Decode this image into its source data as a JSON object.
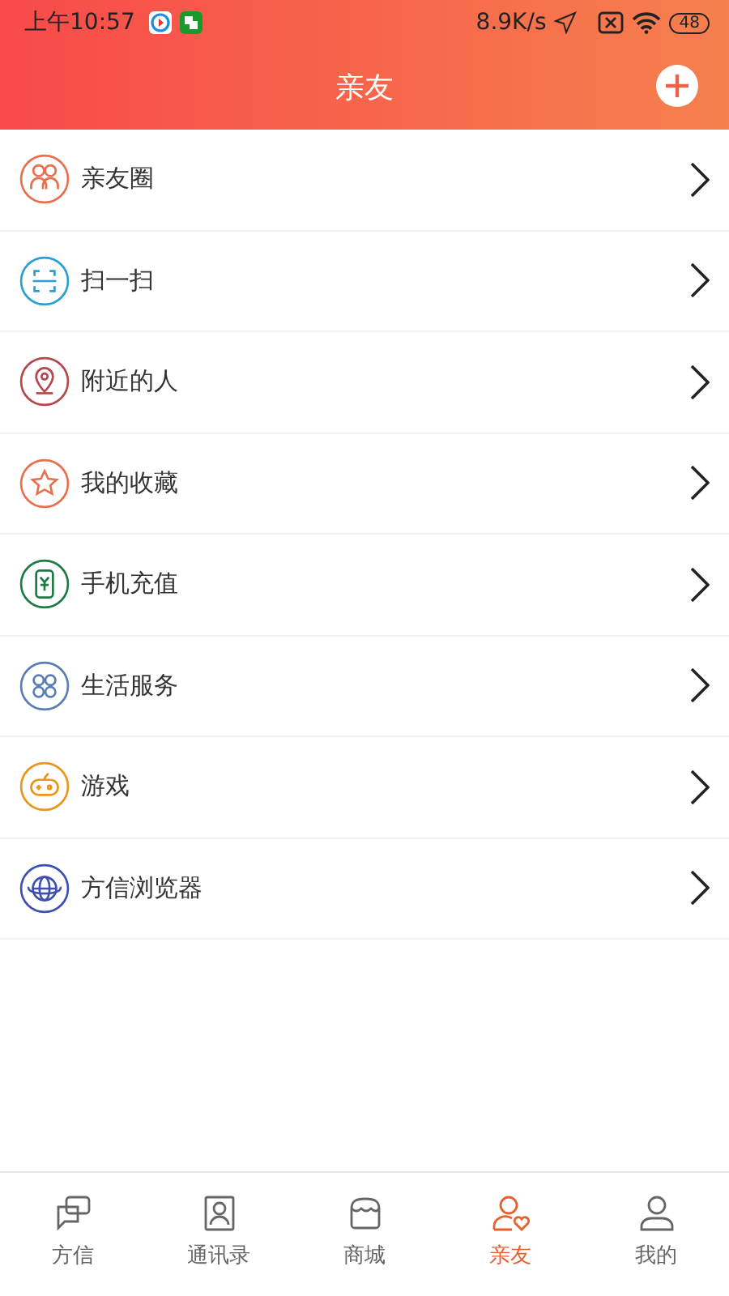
{
  "status_bar": {
    "time": "上午10:57",
    "speed": "8.9K/s",
    "battery": "48"
  },
  "header": {
    "title": "亲友"
  },
  "menu": [
    {
      "kind": "friends",
      "label": "亲友圈",
      "color": "#e8704f"
    },
    {
      "kind": "scan",
      "label": "扫一扫",
      "color": "#2a9fd0"
    },
    {
      "kind": "location",
      "label": "附近的人",
      "color": "#b5474e"
    },
    {
      "kind": "star",
      "label": "我的收藏",
      "color": "#e8704f"
    },
    {
      "kind": "recharge",
      "label": "手机充值",
      "color": "#1e7a45"
    },
    {
      "kind": "services",
      "label": "生活服务",
      "color": "#5a7db5"
    },
    {
      "kind": "game",
      "label": "游戏",
      "color": "#e8961e"
    },
    {
      "kind": "browser",
      "label": "方信浏览器",
      "color": "#3f4fb0"
    }
  ],
  "tabs": [
    {
      "kind": "chat",
      "label": "方信",
      "selected": false
    },
    {
      "kind": "contacts",
      "label": "通讯录",
      "selected": false
    },
    {
      "kind": "shop",
      "label": "商城",
      "selected": false
    },
    {
      "kind": "friends",
      "label": "亲友",
      "selected": true
    },
    {
      "kind": "me",
      "label": "我的",
      "selected": false
    }
  ]
}
